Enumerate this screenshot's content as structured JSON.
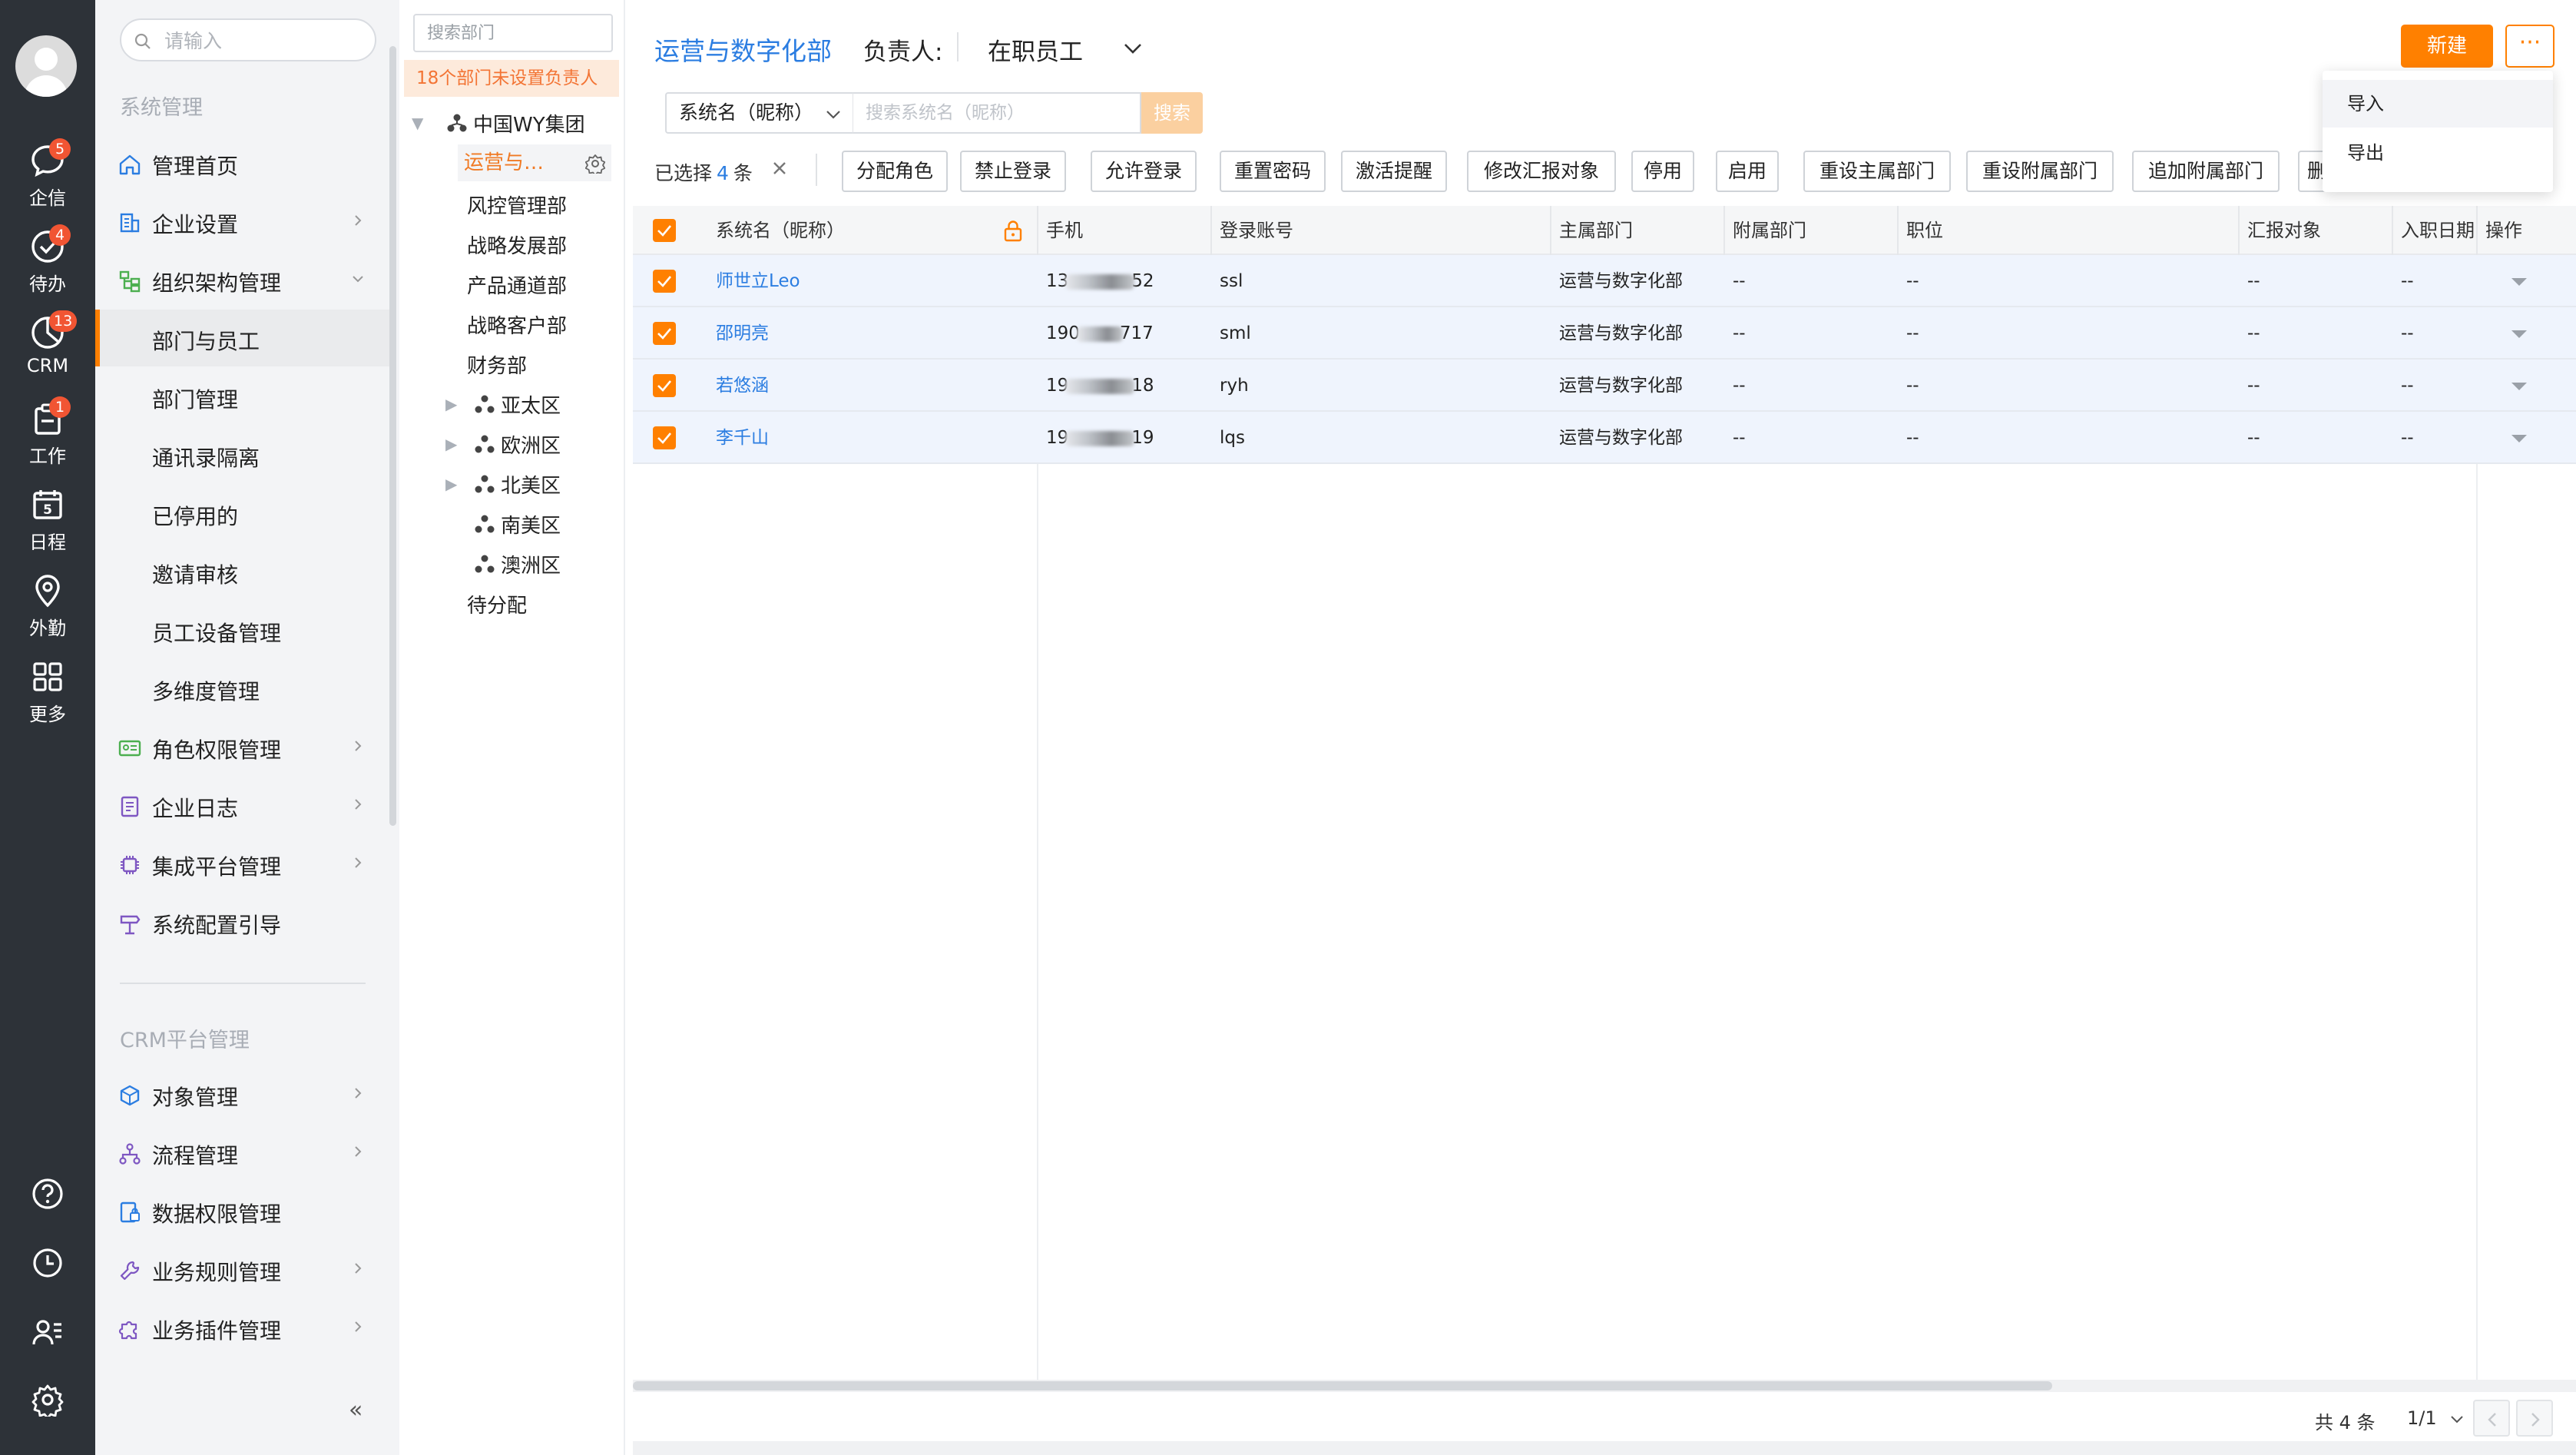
{
  "rail": {
    "items": [
      {
        "label": "企信",
        "badge": "5"
      },
      {
        "label": "待办",
        "badge": "4"
      },
      {
        "label": "CRM",
        "badge": "13"
      },
      {
        "label": "工作",
        "badge": "1"
      },
      {
        "label": "日程",
        "badge": "",
        "day": "5"
      },
      {
        "label": "外勤",
        "badge": ""
      },
      {
        "label": "更多",
        "badge": ""
      }
    ]
  },
  "menu": {
    "search_placeholder": "请输入",
    "group1": "系统管理",
    "items": [
      {
        "label": "管理首页"
      },
      {
        "label": "企业设置"
      },
      {
        "label": "组织架构管理"
      },
      {
        "label": "部门与员工"
      },
      {
        "label": "部门管理"
      },
      {
        "label": "通讯录隔离"
      },
      {
        "label": "已停用的"
      },
      {
        "label": "邀请审核"
      },
      {
        "label": "员工设备管理"
      },
      {
        "label": "多维度管理"
      },
      {
        "label": "角色权限管理"
      },
      {
        "label": "企业日志"
      },
      {
        "label": "集成平台管理"
      },
      {
        "label": "系统配置引导"
      }
    ],
    "group2": "CRM平台管理",
    "crm_items": [
      {
        "label": "对象管理"
      },
      {
        "label": "流程管理"
      },
      {
        "label": "数据权限管理"
      },
      {
        "label": "业务规则管理"
      },
      {
        "label": "业务插件管理"
      }
    ],
    "collapse": "«"
  },
  "tree": {
    "search_placeholder": "搜索部门",
    "warning": "18个部门未设置负责人",
    "root": "中国WY集团",
    "nodes": [
      "运营与…",
      "风控管理部",
      "战略发展部",
      "产品通道部",
      "战略客户部",
      "财务部",
      "亚太区",
      "欧洲区",
      "北美区",
      "南美区",
      "澳洲区",
      "待分配"
    ]
  },
  "header": {
    "dept_title": "运营与数字化部",
    "owner_label": "负责人:",
    "status_value": "在职员工",
    "new_label": "新建",
    "more_label": "···"
  },
  "filter": {
    "field_value": "系统名（昵称）",
    "search_placeholder": "搜索系统名（昵称）",
    "search_label": "搜索"
  },
  "selection": {
    "prefix": "已选择",
    "count": "4",
    "suffix": "条"
  },
  "actions": [
    "分配角色",
    "禁止登录",
    "允许登录",
    "重置密码",
    "激活提醒",
    "修改汇报对象",
    "停用",
    "启用",
    "重设主属部门",
    "重设附属部门",
    "追加附属部门",
    "删"
  ],
  "table": {
    "columns": [
      "系统名（昵称）",
      "手机",
      "登录账号",
      "主属部门",
      "附属部门",
      "职位",
      "汇报对象",
      "入职日期",
      "操作"
    ],
    "rows": [
      {
        "name": "师世立Leo",
        "phone_a": "13",
        "phone_b": "52",
        "account": "ssl",
        "dept": "运营与数字化部",
        "sub_dept": "--",
        "position": "--",
        "report_to": "--",
        "hire_date": "--"
      },
      {
        "name": "邵明亮",
        "phone_a": "190",
        "phone_b": "717",
        "account": "sml",
        "dept": "运营与数字化部",
        "sub_dept": "--",
        "position": "--",
        "report_to": "--",
        "hire_date": "--"
      },
      {
        "name": "若悠涵",
        "phone_a": "19",
        "phone_b": "18",
        "account": "ryh",
        "dept": "运营与数字化部",
        "sub_dept": "--",
        "position": "--",
        "report_to": "--",
        "hire_date": "--"
      },
      {
        "name": "李千山",
        "phone_a": "19",
        "phone_b": "19",
        "account": "lqs",
        "dept": "运营与数字化部",
        "sub_dept": "--",
        "position": "--",
        "report_to": "--",
        "hire_date": "--"
      }
    ]
  },
  "pager": {
    "total": "共 4 条",
    "page": "1/1"
  },
  "dropdown": {
    "items": [
      "导入",
      "导出"
    ]
  },
  "colors": {
    "accent": "#ff8000",
    "link": "#2b7de1",
    "rail": "#2d3238",
    "badge": "#f15533"
  }
}
